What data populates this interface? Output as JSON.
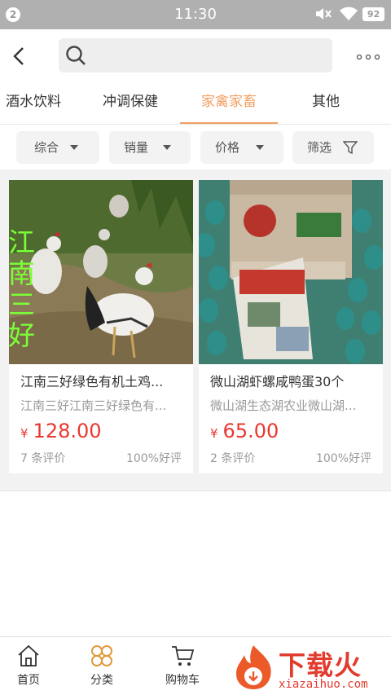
{
  "status_bar": {
    "badge": "2",
    "time": "11:30",
    "battery": "92"
  },
  "header": {
    "search_placeholder": ""
  },
  "category_tabs": [
    {
      "label": "酒水饮料",
      "active": false
    },
    {
      "label": "冲调保健",
      "active": false
    },
    {
      "label": "家禽家畜",
      "active": true
    },
    {
      "label": "其他",
      "active": false
    }
  ],
  "filters": [
    {
      "label": "综合"
    },
    {
      "label": "销量"
    },
    {
      "label": "价格"
    },
    {
      "label": "筛选"
    }
  ],
  "products": [
    {
      "title": "江南三好绿色有机土鸡...",
      "subtitle": "江南三好江南三好绿色有...",
      "currency": "¥",
      "price": "128.00",
      "reviews": "7 条评价",
      "rating": "100%好评",
      "image_text": "江南三好"
    },
    {
      "title": "微山湖虾螺咸鸭蛋30个",
      "subtitle": "微山湖生态湖农业微山湖...",
      "currency": "¥",
      "price": "65.00",
      "reviews": "2 条评价",
      "rating": "100%好评"
    }
  ],
  "bottom_nav": [
    {
      "label": "首页",
      "icon": "home-icon"
    },
    {
      "label": "分类",
      "icon": "category-icon"
    },
    {
      "label": "购物车",
      "icon": "cart-icon"
    }
  ],
  "watermark": {
    "text": "下载火",
    "url": "xiazaihuo.com"
  },
  "colors": {
    "accent": "#f29f62",
    "price": "#e8382f",
    "status_bar": "#b0b0b0"
  }
}
